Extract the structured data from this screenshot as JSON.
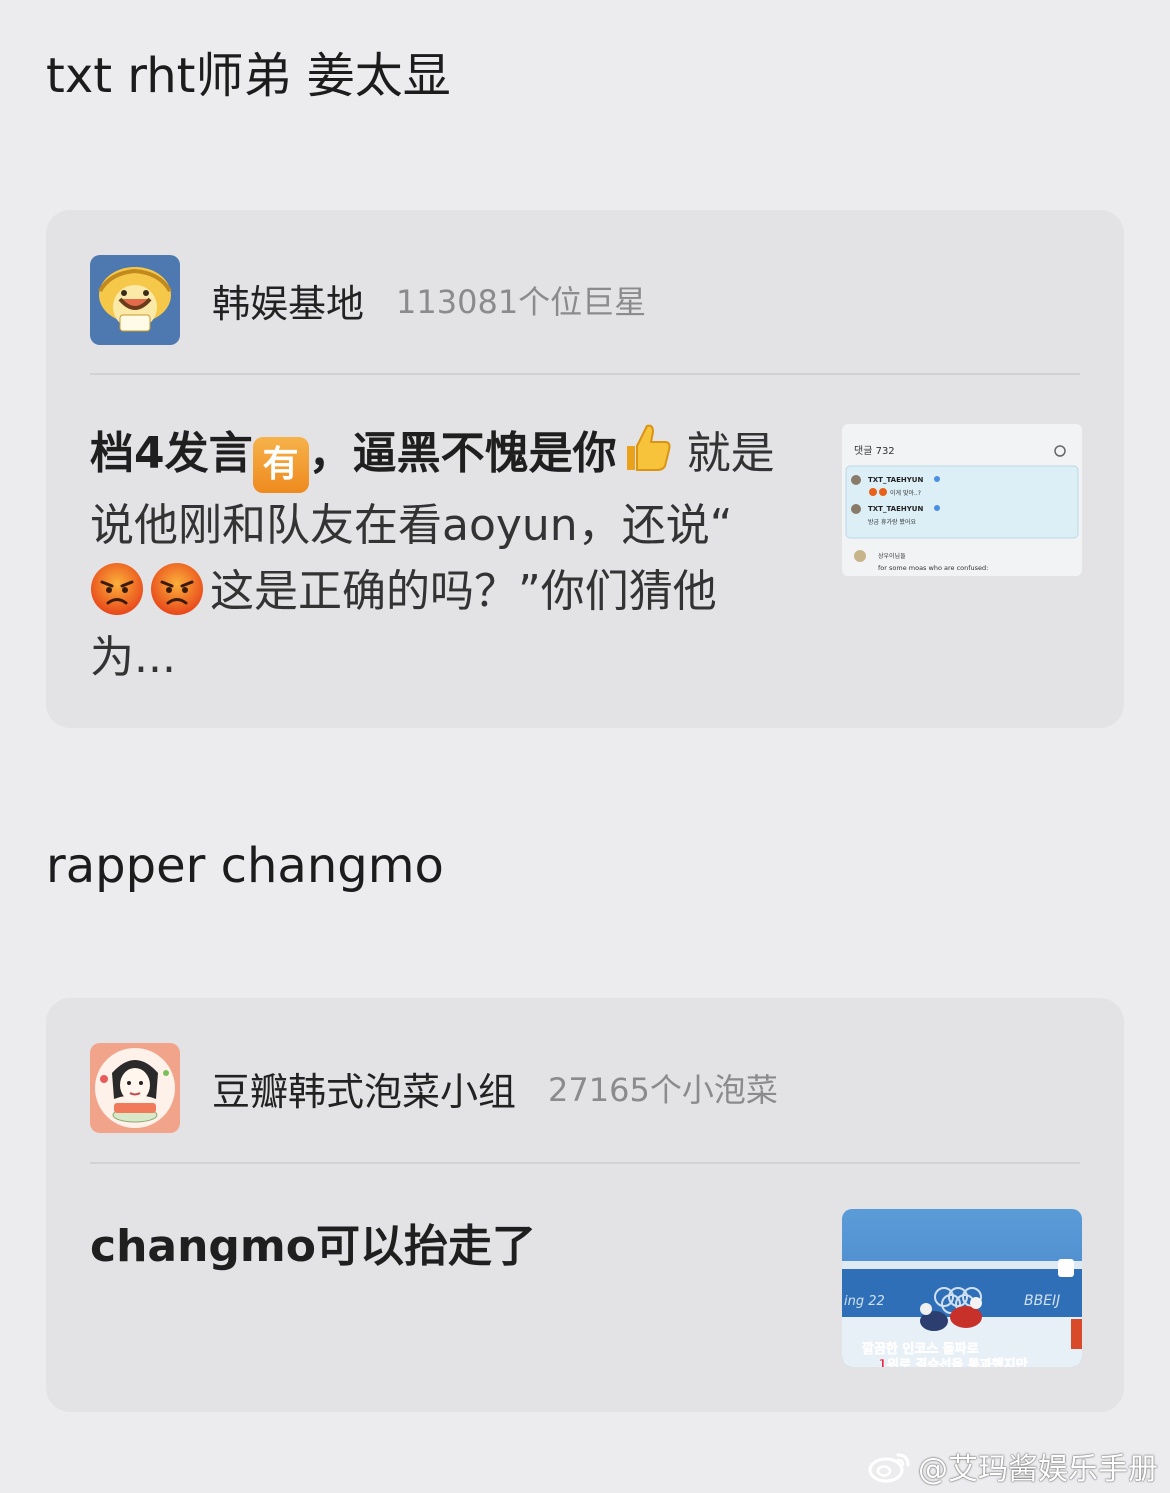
{
  "sections": [
    {
      "title": "txt  rht师弟 姜太显",
      "card": {
        "group_name": "韩娱基地",
        "member_count": "113081个位巨星",
        "avatar_icon": "smiling-cartoon-avatar",
        "post": {
          "lead_text": "档4发言",
          "emoji_you_char": "有",
          "lead_text2": "，逼黑不愧是你",
          "body_text1": " 就是说他刚和队友在看aoyun，还说“",
          "body_text2": "这是正确的吗？”你们猜他为..."
        },
        "thumbnail": {
          "comment_header": "댓글 732",
          "user1": "TXT_TAEHYUN",
          "line1": "이게 맞아..?",
          "user2": "TXT_TAEHYUN",
          "line2": "방금 휴가랑 봤어요",
          "user3": "상우이님들",
          "line3": "for some moas who are confused:"
        }
      }
    },
    {
      "title": "rapper changmo",
      "card": {
        "group_name": "豆瓣韩式泡菜小组",
        "member_count": "27165个小泡菜",
        "avatar_icon": "cartoon-girl-cooking-avatar",
        "post": {
          "text": "changmo可以抬走了"
        },
        "thumbnail": {
          "overlay_text1": "깔끔한 인코스 돌파로",
          "overlay_text2": "1위로 결승선을 통과했지만",
          "banner_text": "BBEIJ",
          "banner_text_left": "ing 22"
        }
      }
    }
  ],
  "watermark": {
    "text": "@艾玛酱娱乐手册",
    "icon": "weibo-logo-icon"
  },
  "colors": {
    "background": "#ececee",
    "card": "#e3e3e5",
    "muted_text": "#8b8b8e",
    "emoji_orange": "#ee8a1e"
  }
}
